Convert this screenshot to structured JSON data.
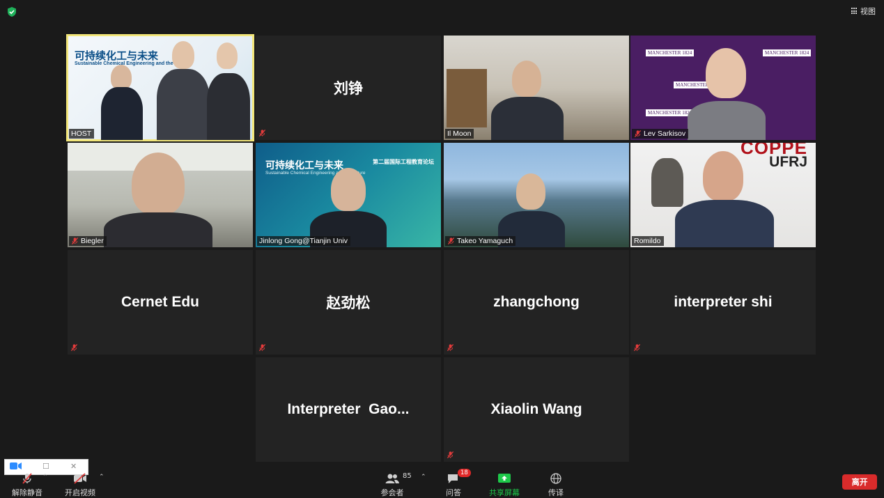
{
  "header": {
    "view_label": "视图"
  },
  "participants": [
    {
      "name": "HOST",
      "type": "video"
    },
    {
      "name": "刘铮",
      "type": "name"
    },
    {
      "name": "Il Moon",
      "type": "video"
    },
    {
      "name": "Lev Sarkisov",
      "type": "video"
    },
    {
      "name": "Biegler",
      "type": "video"
    },
    {
      "name": "Jinlong Gong@Tianjin Univ",
      "type": "video"
    },
    {
      "name": "Takeo Yamaguch",
      "type": "video"
    },
    {
      "name": "Romildo",
      "type": "video"
    },
    {
      "name": "Cernet Edu",
      "type": "name"
    },
    {
      "name": "赵劲松",
      "type": "name"
    },
    {
      "name": "zhangchong",
      "type": "name"
    },
    {
      "name": "interpreter shi",
      "type": "name"
    },
    {
      "name": "Interpreter  Gao...",
      "type": "name"
    },
    {
      "name": "Xiaolin Wang",
      "type": "name"
    }
  ],
  "banner": {
    "title_cn": "可持续化工与未来",
    "title_en": "Sustainable Chemical Engineering and the Future",
    "forum_cn": "第二届国际工程教育论坛"
  },
  "logos": {
    "manchester": "MANCHESTER 1824",
    "coppe": "COPPE",
    "ufrj": "UFRJ"
  },
  "toolbar": {
    "unmute": "解除静音",
    "start_video": "开启视频",
    "participants": "参会者",
    "participants_count": "85",
    "qa": "问答",
    "qa_badge": "18",
    "share_screen": "共享屏幕",
    "interpret": "传译",
    "leave": "离开"
  },
  "colors": {
    "active_speaker": "#f2e67a",
    "share_green": "#1ec94a",
    "leave_red": "#d92b2b",
    "mute_red": "#e23b3b"
  }
}
